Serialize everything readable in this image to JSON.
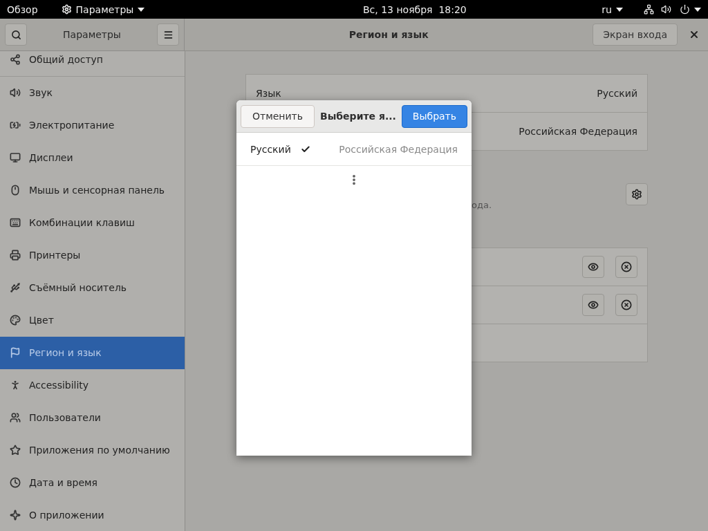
{
  "top_bar": {
    "activities": "Обзор",
    "app_menu": "Параметры",
    "clock": "Вс, 13 ноября  18:20",
    "keyboard_layout": "ru"
  },
  "header_bar": {
    "sidebar_title": "Параметры",
    "page_title": "Регион и язык",
    "login_screen_button": "Экран входа"
  },
  "sidebar": {
    "items": [
      {
        "label": "Общий доступ",
        "selected": false
      },
      {
        "label": "Звук",
        "selected": false
      },
      {
        "label": "Электропитание",
        "selected": false
      },
      {
        "label": "Дисплеи",
        "selected": false
      },
      {
        "label": "Мышь и сенсорная панель",
        "selected": false
      },
      {
        "label": "Комбинации клавиш",
        "selected": false
      },
      {
        "label": "Принтеры",
        "selected": false
      },
      {
        "label": "Съёмный носитель",
        "selected": false
      },
      {
        "label": "Цвет",
        "selected": false
      },
      {
        "label": "Регион и язык",
        "selected": true
      },
      {
        "label": "Accessibility",
        "selected": false
      },
      {
        "label": "Пользователи",
        "selected": false
      },
      {
        "label": "Приложения по умолчанию",
        "selected": false
      },
      {
        "label": "Дата и время",
        "selected": false
      },
      {
        "label": "О приложении",
        "selected": false
      }
    ]
  },
  "language_rows": [
    {
      "label": "Язык",
      "value": "Русский"
    },
    {
      "value": "Российская Федерация"
    }
  ],
  "input_sources": {
    "hint": "ода.",
    "rows": [
      {
        "kind": "source"
      },
      {
        "kind": "source"
      },
      {
        "kind": "add"
      }
    ]
  },
  "dialog": {
    "cancel": "Отменить",
    "title": "Выберите я...",
    "confirm": "Выбрать",
    "languages": [
      {
        "name": "Русский",
        "region": "Российская Федерация",
        "selected": true
      }
    ],
    "more": true
  }
}
